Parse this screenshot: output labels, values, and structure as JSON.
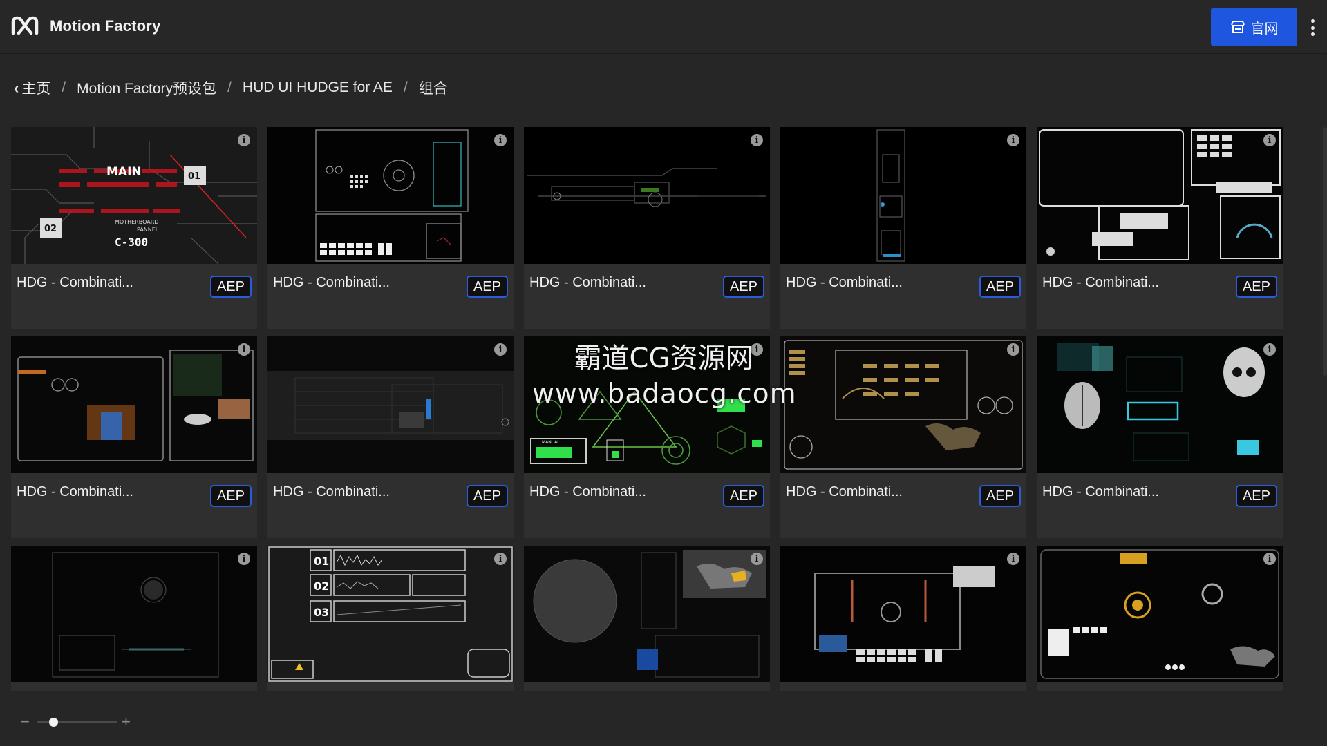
{
  "header": {
    "app_title": "Motion Factory",
    "site_button_label": "官网",
    "accent_color": "#1f56e0"
  },
  "breadcrumb": {
    "items": [
      "主页",
      "Motion Factory预设包",
      "HUD UI HUDGE for AE",
      "组合"
    ],
    "separator": "/"
  },
  "grid": {
    "cards": [
      {
        "title": "HDG - Combinati...",
        "badge": "AEP"
      },
      {
        "title": "HDG - Combinati...",
        "badge": "AEP"
      },
      {
        "title": "HDG - Combinati...",
        "badge": "AEP"
      },
      {
        "title": "HDG - Combinati...",
        "badge": "AEP"
      },
      {
        "title": "HDG - Combinati...",
        "badge": "AEP"
      },
      {
        "title": "HDG - Combinati...",
        "badge": "AEP"
      },
      {
        "title": "HDG - Combinati...",
        "badge": "AEP"
      },
      {
        "title": "HDG - Combinati...",
        "badge": "AEP"
      },
      {
        "title": "HDG - Combinati...",
        "badge": "AEP"
      },
      {
        "title": "HDG - Combinati...",
        "badge": "AEP"
      },
      {
        "title": "",
        "badge": ""
      },
      {
        "title": "",
        "badge": ""
      },
      {
        "title": "",
        "badge": ""
      },
      {
        "title": "",
        "badge": ""
      },
      {
        "title": "",
        "badge": ""
      }
    ],
    "thumb_text": {
      "card1": [
        "MAIN",
        "01",
        "02",
        "MOTHERBOARD",
        "PANNEL",
        "C-300"
      ],
      "card8": [
        "MANUAL"
      ],
      "card12": [
        "01",
        "02",
        "03"
      ]
    }
  },
  "watermark": {
    "line1": "霸道CG资源网",
    "line2": "www.badaocg.com"
  },
  "zoom": {
    "minus": "−",
    "plus": "+",
    "level": 0.2
  },
  "icons": {
    "logo": "motion-factory-logo-icon",
    "site_button": "store-icon",
    "menu": "kebab-menu-icon",
    "back": "chevron-left-icon",
    "info": "info-icon"
  }
}
